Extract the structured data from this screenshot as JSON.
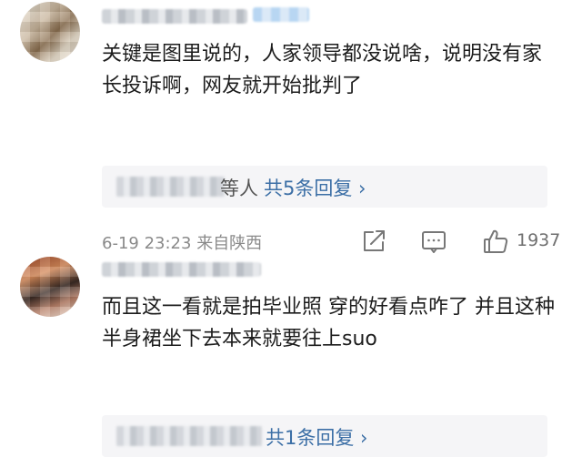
{
  "comments": [
    {
      "text": "关键是图里说的，人家领导都没说啥，说明没有家长投诉啊，网友就开始批判了",
      "reply_suffix": "等人",
      "reply_link": "共5条回复 ›",
      "time": "6-19 23:23",
      "location": "来自陕西",
      "like_count": "1937"
    },
    {
      "text": "而且这一看就是拍毕业照 穿的好看点咋了 并且这种半身裙坐下去本来就要往上suo",
      "reply_link": "共1条回复 ›"
    }
  ],
  "icons": {
    "share": "share-icon",
    "comment": "comment-icon",
    "like": "thumbs-up-icon"
  },
  "colors": {
    "link": "#3c6fa6",
    "meta": "#8a8a8a",
    "reply_bg": "#f5f5f7"
  }
}
